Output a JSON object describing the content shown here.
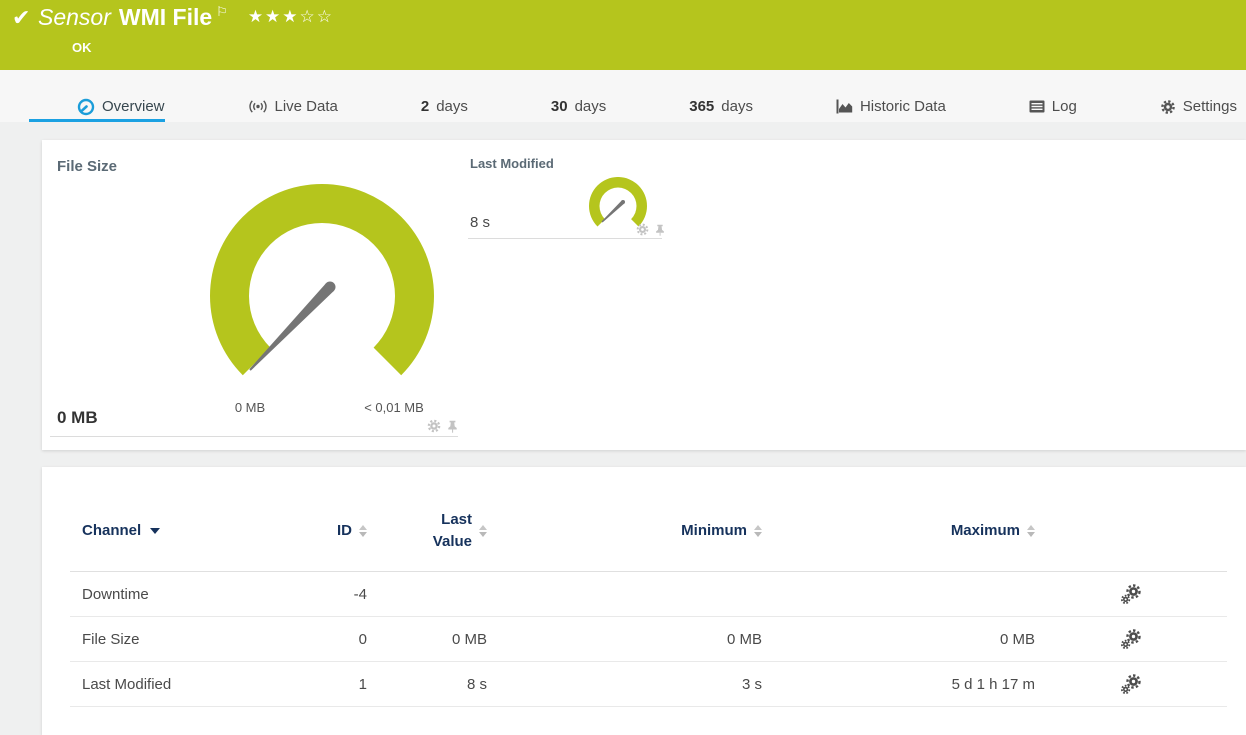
{
  "header": {
    "kind_label": "Sensor",
    "sensor_name": "WMI File",
    "status": "OK",
    "rating_filled": "★★★",
    "rating_empty": "☆☆",
    "colors": {
      "bg": "#b5c51d",
      "text": "#ffffff"
    }
  },
  "tabs": [
    {
      "label": "Overview",
      "icon": "gauge-icon",
      "active": true
    },
    {
      "label": "Live Data",
      "icon": "live-icon"
    },
    {
      "num": "2",
      "label": "days"
    },
    {
      "num": "30",
      "label": "days"
    },
    {
      "num": "365",
      "label": "days"
    },
    {
      "label": "Historic Data",
      "icon": "area-chart-icon"
    },
    {
      "label": "Log",
      "icon": "log-icon"
    },
    {
      "label": "Settings",
      "icon": "gear-icon"
    }
  ],
  "gauges": {
    "primary": {
      "title": "File Size",
      "current_value": "0 MB",
      "min_label": "0 MB",
      "max_label": "< 0,01 MB",
      "needle_at": "minimum",
      "color": "#b5c51d"
    },
    "secondary": {
      "title": "Last Modified",
      "current_value": "8 s",
      "needle_at": "low",
      "color": "#b5c51d"
    }
  },
  "channels_table": {
    "columns": [
      "Channel",
      "ID",
      "Last Value",
      "Minimum",
      "Maximum"
    ],
    "sorted_by": "Channel",
    "rows": [
      {
        "channel": "Downtime",
        "id": "-4",
        "last_value": "",
        "minimum": "",
        "maximum": ""
      },
      {
        "channel": "File Size",
        "id": "0",
        "last_value": "0 MB",
        "minimum": "0 MB",
        "maximum": "0 MB"
      },
      {
        "channel": "Last Modified",
        "id": "1",
        "last_value": "8 s",
        "minimum": "3 s",
        "maximum": "5 d 1 h 17 m"
      }
    ]
  }
}
